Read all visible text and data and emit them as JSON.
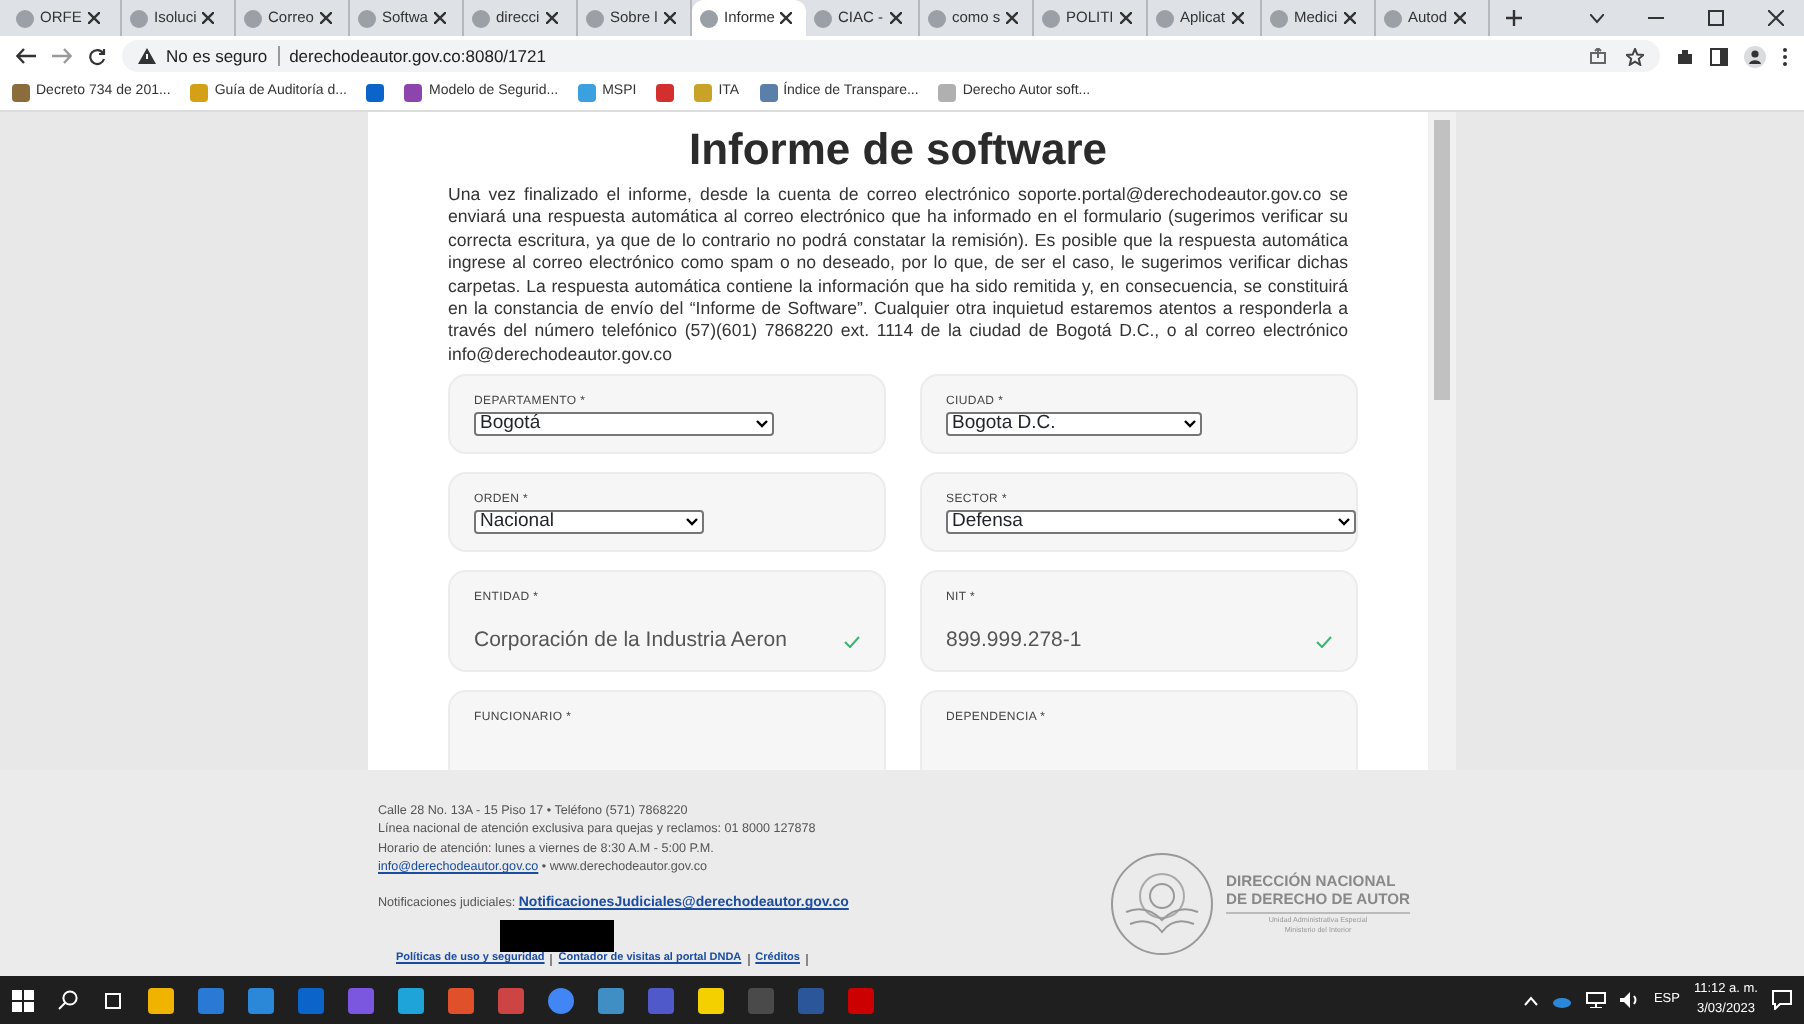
{
  "tabs": [
    {
      "label": "ORFE",
      "selected": false
    },
    {
      "label": "Isoluci",
      "selected": false
    },
    {
      "label": "Correo",
      "selected": false
    },
    {
      "label": "Softwa",
      "selected": false
    },
    {
      "label": "direcci",
      "selected": false
    },
    {
      "label": "Sobre l",
      "selected": false
    },
    {
      "label": "Informe",
      "selected": true
    },
    {
      "label": "CIAC -",
      "selected": false
    },
    {
      "label": "como s",
      "selected": false
    },
    {
      "label": "POLITI",
      "selected": false
    },
    {
      "label": "Aplicat",
      "selected": false
    },
    {
      "label": "Medici",
      "selected": false
    },
    {
      "label": "Autod",
      "selected": false
    }
  ],
  "address_bar": {
    "security": "No es seguro",
    "url": "derechodeautor.gov.co:8080/1721"
  },
  "bookmarks": [
    {
      "kind": "link",
      "label": "Decreto 734 de 201..."
    },
    {
      "kind": "link",
      "label": "Guía de Auditoría d..."
    },
    {
      "kind": "icon"
    },
    {
      "kind": "link",
      "label": "Modelo de Segurid..."
    },
    {
      "kind": "link",
      "label": "MSPI"
    },
    {
      "kind": "icon"
    },
    {
      "kind": "link",
      "label": "ITA"
    },
    {
      "kind": "link",
      "label": "Índice de Transpare..."
    },
    {
      "kind": "link",
      "label": "Derecho Autor soft..."
    }
  ],
  "page": {
    "title": "Informe de software",
    "intro": "Una vez finalizado el informe, desde la cuenta de correo electrónico soporte.portal@derechodeautor.gov.co se enviará una respuesta automática al correo electrónico que ha informado en el formulario (sugerimos verificar su correcta escritura, ya que de lo contrario no podrá constatar la remisión). Es posible que la respuesta automática ingrese al correo electrónico como spam o no deseado, por lo que, de ser el caso, le sugerimos verificar dichas carpetas. La respuesta automática contiene la información que ha sido remitida y, en consecuencia, se constituirá en la constancia de envío del “Informe de Software”. Cualquier otra inquietud estaremos atentos a responderla a través del número telefónico (57)(601) 7868220 ext. 1114 de la ciudad de Bogotá D.C., o al correo electrónico info@derechodeautor.gov.co",
    "fields": [
      {
        "kind": "select",
        "label": "DEPARTAMENTO *",
        "value": "Bogotá"
      },
      {
        "kind": "select",
        "label": "CIUDAD *",
        "value": "Bogota D.C."
      },
      {
        "kind": "select",
        "label": "ORDEN *",
        "value": "Nacional"
      },
      {
        "kind": "select",
        "label": "SECTOR *",
        "value": "Defensa"
      },
      {
        "kind": "text",
        "label": "ENTIDAD *",
        "value": "Corporación de la Industria Aeron",
        "valid": true
      },
      {
        "kind": "text",
        "label": "NIT *",
        "value": "899.999.278-1",
        "valid": true
      },
      {
        "kind": "text",
        "label": "FUNCIONARIO *"
      },
      {
        "kind": "text",
        "label": "DEPENDENCIA *"
      }
    ]
  },
  "footer": {
    "lines": [
      "Calle 28 No. 13A - 15 Piso 17 • Teléfono (571) 7868220",
      "Línea nacional de atención exclusiva para quejas y reclamos: 01 8000 127878",
      "Horario de atención: lunes a viernes de 8:30 A.M - 5:00 P.M."
    ],
    "email": "info@derechodeautor.gov.co",
    "website": "• www.derechodeautor.gov.co",
    "notifications_label": "Notificaciones judiciales:",
    "notifications_email": "NotificacionesJudiciales@derechodeautor.gov.co",
    "links": [
      "Políticas de uso y seguridad",
      "Contador de visitas al portal DNDA",
      "Créditos"
    ],
    "logo": {
      "name_lines": [
        "DIRECCIÓN NACIONAL",
        "DE DERECHO DE AUTOR"
      ],
      "subtitle_lines": [
        "Unidad Administrativa Especial",
        "Ministerio del Interior"
      ]
    }
  },
  "taskbar": {
    "language": "ESP",
    "time": "11:12 a. m.",
    "date": "3/03/2023"
  }
}
